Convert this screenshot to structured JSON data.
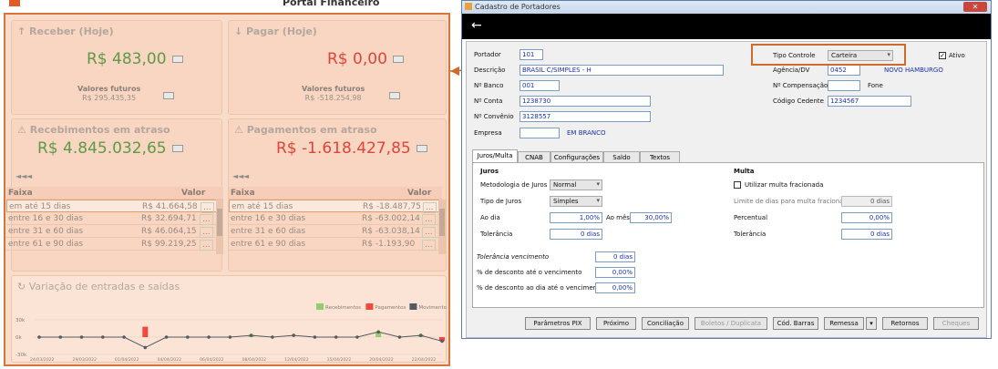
{
  "left": {
    "app_title": "Portal Financeiro",
    "receber": {
      "title": "Receber (Hoje)",
      "amount": "R$ 483,00",
      "fut_label": "Valores futuros",
      "fut_value": "R$ 295.435,35"
    },
    "pagar": {
      "title": "Pagar (Hoje)",
      "amount": "R$ 0,00",
      "fut_label": "Valores futuros",
      "fut_value": "R$ -518.254,98"
    },
    "receb_atraso": {
      "title": "Recebimentos em atraso",
      "amount": "R$ 4.845.032,65"
    },
    "pag_atraso": {
      "title": "Pagamentos em atraso",
      "amount": "R$ -1.618.427,85"
    },
    "table_headers": {
      "faixa": "Faixa",
      "valor": "Valor"
    },
    "receb_rows": [
      {
        "faixa": "em até 15 dias",
        "valor": "R$ 41.664,58"
      },
      {
        "faixa": "entre 16 e 30 dias",
        "valor": "R$ 32.694,71"
      },
      {
        "faixa": "entre 31 e 60 dias",
        "valor": "R$ 46.064,15"
      },
      {
        "faixa": "entre 61 e 90 dias",
        "valor": "R$ 99.219,25"
      }
    ],
    "pag_rows": [
      {
        "faixa": "em até 15 dias",
        "valor": "R$ -18.487,75"
      },
      {
        "faixa": "entre 16 e 30 dias",
        "valor": "R$ -63.002,14"
      },
      {
        "faixa": "entre 31 e 60 dias",
        "valor": "R$ -63.038,14"
      },
      {
        "faixa": "entre 61 e 90 dias",
        "valor": "R$ -1.193,90"
      }
    ],
    "more_label": "...",
    "chart_title": "Variação de entradas e saídas",
    "legend": [
      {
        "name": "Recebimentos",
        "color": "#8fce6a"
      },
      {
        "name": "Pagamentos",
        "color": "#f0483c"
      },
      {
        "name": "Movimento",
        "color": "#555a60"
      }
    ],
    "yticks": [
      "30k",
      "0k",
      "-30k"
    ],
    "xticks": [
      "24/03/2022",
      "29/03/2022",
      "01/04/2022",
      "04/04/2022",
      "06/04/2022",
      "08/04/2022",
      "12/04/2022",
      "15/04/2022",
      "20/04/2022",
      "22/04/2022"
    ]
  },
  "chart_data": {
    "type": "line",
    "title": "Variação de entradas e saídas",
    "xlabel": "",
    "ylabel": "",
    "ylim": [
      -30000,
      30000
    ],
    "legend_position": "top-right",
    "categories": [
      "24/03/2022",
      "",
      "29/03/2022",
      "",
      "01/04/2022",
      "",
      "04/04/2022",
      "",
      "06/04/2022",
      "",
      "08/04/2022",
      "",
      "12/04/2022",
      "",
      "15/04/2022",
      "",
      "20/04/2022",
      "",
      "22/04/2022",
      ""
    ],
    "series": [
      {
        "name": "Recebimentos",
        "type": "bar",
        "values": [
          0,
          0,
          0,
          0,
          0,
          0,
          0,
          0,
          0,
          0,
          4000,
          0,
          0,
          0,
          0,
          0,
          9000,
          0,
          4000,
          0
        ]
      },
      {
        "name": "Pagamentos",
        "type": "bar",
        "values": [
          0,
          0,
          0,
          0,
          0,
          18000,
          0,
          0,
          0,
          0,
          0,
          0,
          0,
          0,
          0,
          0,
          0,
          0,
          0,
          -7000
        ]
      },
      {
        "name": "Movimento",
        "type": "line",
        "values": [
          0,
          0,
          0,
          0,
          0,
          -18000,
          0,
          0,
          0,
          0,
          3000,
          0,
          3000,
          0,
          0,
          0,
          9000,
          0,
          3000,
          -7000
        ]
      }
    ]
  },
  "window": {
    "title": "Cadastro de Portadores",
    "close_label": "✕",
    "back_label": "←",
    "fields": {
      "portador_label": "Portador",
      "portador_value": "101",
      "descricao_label": "Descrição",
      "descricao_value": "BRASIL C/SIMPLES - H",
      "banco_label": "Nº Banco",
      "banco_value": "001",
      "conta_label": "Nº Conta",
      "conta_value": "1238730",
      "convenio_label": "Nº Convênio",
      "convenio_value": "3128557",
      "empresa_label": "Empresa",
      "empresa_value": "",
      "empresa_text": "EM BRANCO",
      "tipo_controle_label": "Tipo Controle",
      "tipo_controle_value": "Carteira",
      "ativo_label": "Ativo",
      "agencia_label": "Agência/DV",
      "agencia_value": "0452",
      "agencia_text": "NOVO HAMBURGO",
      "compensacao_label": "Nº Compensação",
      "compensacao_value": "",
      "fone_label": "Fone",
      "cedente_label": "Código Cedente",
      "cedente_value": "1234567"
    },
    "tabs": [
      "Juros/Multa",
      "CNAB",
      "Configurações",
      "Saldo",
      "Textos"
    ],
    "juros": {
      "title": "Juros",
      "metodologia_label": "Metodologia de Juros",
      "metodologia_value": "Normal",
      "tipo_label": "Tipo de Juros",
      "tipo_value": "Simples",
      "ao_dia_label": "Ao dia",
      "ao_dia_value": "1,00%",
      "ao_mes_label": "Ao mês",
      "ao_mes_value": "30,00%",
      "tolerancia_label": "Tolerância",
      "tolerancia_value": "0 dias"
    },
    "multa": {
      "title": "Multa",
      "fracionada_label": "Utilizar multa fracionada",
      "limite_label": "Limite de dias para multa fracionada",
      "limite_value": "0 dias",
      "percentual_label": "Percentual",
      "percentual_value": "0,00%",
      "tolerancia_label": "Tolerância",
      "tolerancia_value": "0 dias"
    },
    "extra": {
      "tol_venc_label": "Tolerância vencimento",
      "tol_venc_value": "0 dias",
      "desc_venc_label": "% de desconto até o vencimento",
      "desc_venc_value": "0,00%",
      "desc_dia_label": "% de desconto ao dia até o vencimento",
      "desc_dia_value": "0,00%"
    },
    "buttons": [
      "Parâmetros PIX",
      "Próximo",
      "Conciliação",
      "Boletos / Duplicata",
      "Cód. Barras",
      "Remessa",
      "▾",
      "Retornos",
      "Cheques"
    ]
  }
}
